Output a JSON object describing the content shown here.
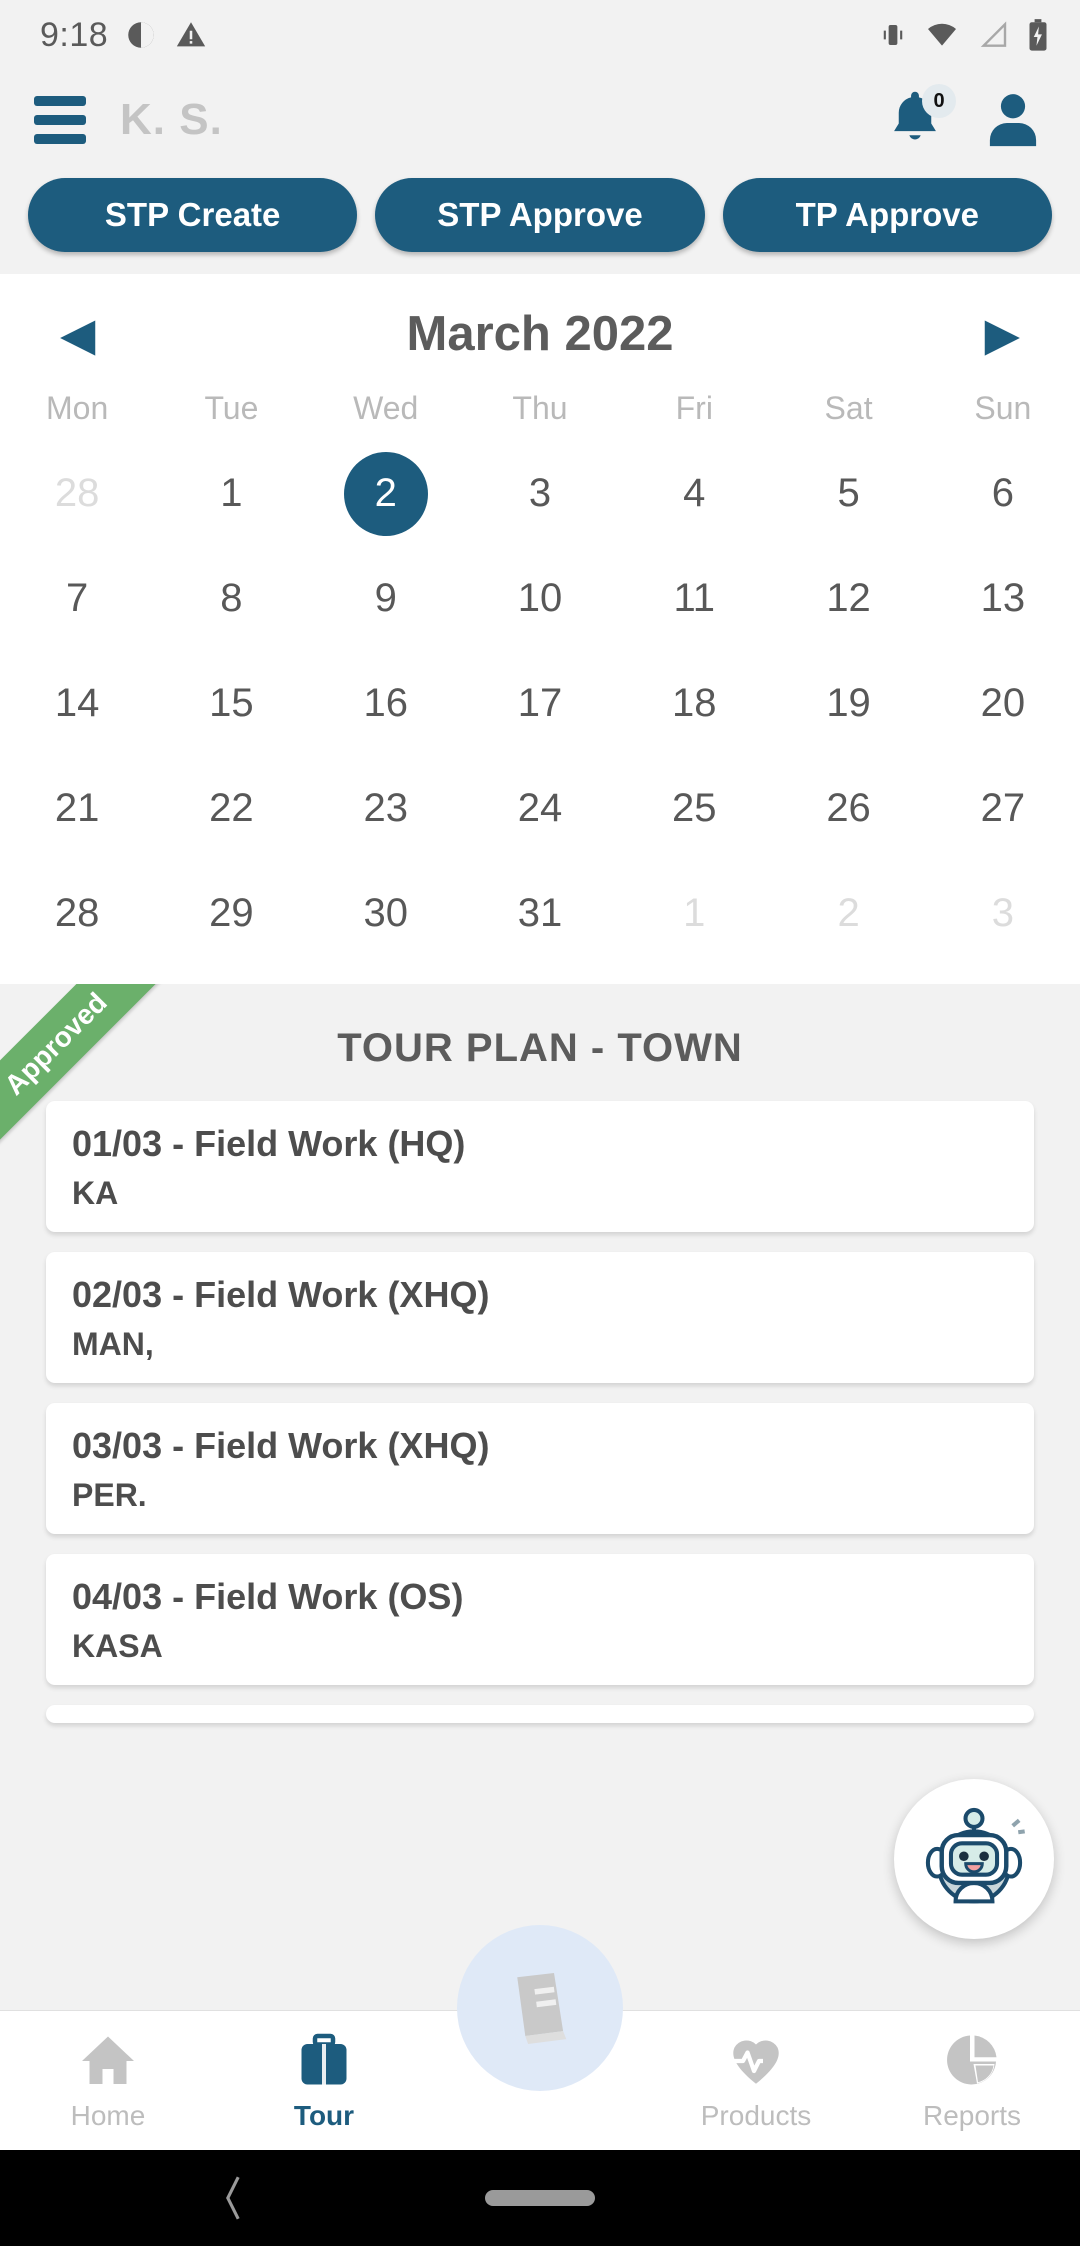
{
  "status_bar": {
    "time": "9:18",
    "left_icons": [
      "brightness-icon",
      "warning-icon"
    ],
    "right_icons": [
      "vibrate-icon",
      "wifi-icon",
      "signal-icon",
      "battery-charging-icon"
    ]
  },
  "app_bar": {
    "menu_icon": "hamburger-menu-icon",
    "title": "K. S.",
    "bell_icon": "notification-bell-icon",
    "bell_badge": "0",
    "profile_icon": "user-profile-icon"
  },
  "action_buttons": [
    {
      "label": "STP Create"
    },
    {
      "label": "STP Approve"
    },
    {
      "label": "TP Approve"
    }
  ],
  "calendar": {
    "prev_label": "◀",
    "next_label": "▶",
    "month": "March 2022",
    "weekdays": [
      "Mon",
      "Tue",
      "Wed",
      "Thu",
      "Fri",
      "Sat",
      "Sun"
    ],
    "weeks": [
      [
        {
          "d": "28",
          "muted": true
        },
        {
          "d": "1"
        },
        {
          "d": "2",
          "selected": true
        },
        {
          "d": "3"
        },
        {
          "d": "4"
        },
        {
          "d": "5"
        },
        {
          "d": "6"
        }
      ],
      [
        {
          "d": "7"
        },
        {
          "d": "8"
        },
        {
          "d": "9"
        },
        {
          "d": "10"
        },
        {
          "d": "11"
        },
        {
          "d": "12"
        },
        {
          "d": "13"
        }
      ],
      [
        {
          "d": "14"
        },
        {
          "d": "15"
        },
        {
          "d": "16"
        },
        {
          "d": "17"
        },
        {
          "d": "18"
        },
        {
          "d": "19"
        },
        {
          "d": "20"
        }
      ],
      [
        {
          "d": "21"
        },
        {
          "d": "22"
        },
        {
          "d": "23"
        },
        {
          "d": "24"
        },
        {
          "d": "25"
        },
        {
          "d": "26"
        },
        {
          "d": "27"
        }
      ],
      [
        {
          "d": "28"
        },
        {
          "d": "29"
        },
        {
          "d": "30"
        },
        {
          "d": "31"
        },
        {
          "d": "1",
          "muted": true
        },
        {
          "d": "2",
          "muted": true
        },
        {
          "d": "3",
          "muted": true
        }
      ]
    ]
  },
  "tour_plan": {
    "ribbon_label": "Approved",
    "ribbon_color": "#6bb06b",
    "title": "TOUR PLAN - TOWN",
    "cards": [
      {
        "title": "01/03  - Field Work  (HQ)",
        "subtitle": "KA"
      },
      {
        "title": "02/03  - Field Work  (XHQ)",
        "subtitle": "MAN,"
      },
      {
        "title": "03/03  - Field Work  (XHQ)",
        "subtitle": "PER."
      },
      {
        "title": "04/03  - Field Work  (OS)",
        "subtitle": "KASA"
      }
    ]
  },
  "chat_fab": {
    "icon": "chatbot-robot-icon"
  },
  "bottom_nav": {
    "items": [
      {
        "label": "Home",
        "icon": "home-icon",
        "active": false
      },
      {
        "label": "Tour",
        "icon": "briefcase-icon",
        "active": true
      },
      {
        "label": "Products",
        "icon": "heartbeat-icon",
        "active": false
      },
      {
        "label": "Reports",
        "icon": "pie-chart-icon",
        "active": false
      }
    ],
    "center_icon": "book-icon"
  },
  "gesture_bar": {
    "back_icon": "back-chevron-icon",
    "home_pill": "home-pill"
  },
  "colors": {
    "accent": "#1d5c7e",
    "approved": "#6bb06b",
    "muted": "#bdbdbd"
  }
}
